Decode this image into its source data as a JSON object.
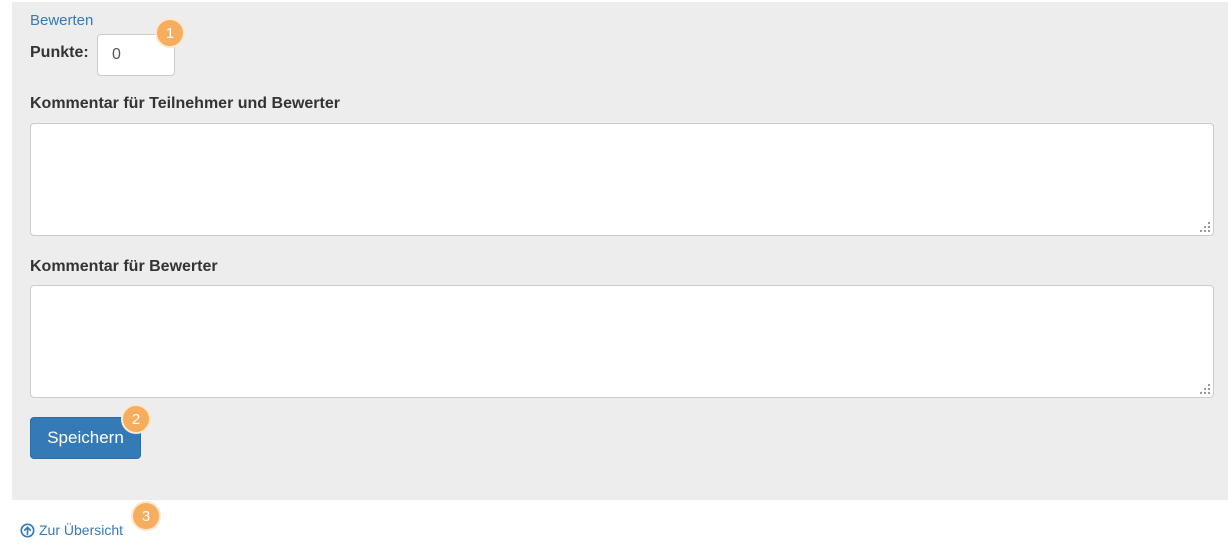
{
  "form": {
    "section_title": "Bewerten",
    "points_label": "Punkte:",
    "points_value": "0",
    "comment_participants_label": "Kommentar für Teilnehmer und Bewerter",
    "comment_participants_value": "",
    "comment_graders_label": "Kommentar für Bewerter",
    "comment_graders_value": "",
    "save_label": "Speichern"
  },
  "footer": {
    "overview_label": "Zur Übersicht",
    "overview_icon": "circle-arrow-up-icon"
  },
  "markers": [
    "1",
    "2",
    "3"
  ],
  "colors": {
    "accent": "#337ab7",
    "panel_bg": "#ededed",
    "marker": "#f6ad5d"
  }
}
